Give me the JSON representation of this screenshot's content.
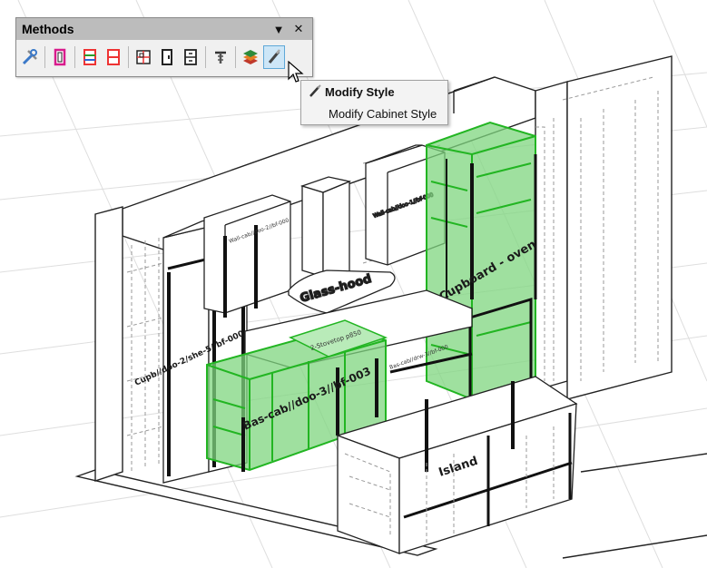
{
  "toolbar": {
    "title": "Methods",
    "buttons": [
      {
        "name": "tools-icon"
      },
      {
        "name": "frame-icon"
      },
      {
        "name": "shelves-color-icon"
      },
      {
        "name": "shelves-red-icon"
      },
      {
        "name": "grid-icon"
      },
      {
        "name": "door-icon"
      },
      {
        "name": "drawer-icon"
      },
      {
        "name": "hinge-icon"
      },
      {
        "name": "layers-icon"
      },
      {
        "name": "brush-icon"
      }
    ]
  },
  "menu": {
    "items": [
      {
        "label": "Modify Style",
        "style": "bold"
      },
      {
        "label": "Modify Cabinet Style",
        "style": "plain"
      }
    ]
  },
  "scene": {
    "labels": {
      "glass_hood": "Glass-hood",
      "cupboard_oven": "Cupboard - oven",
      "bas_cab": "Bas-cab//doo-3//bf-003",
      "cupb": "Cupb//doo-2/she-5//bf-000",
      "island": "Island",
      "stovetop": "2-Stovetop p850",
      "wall_cab_left": "Wall-cab//doo-2//bf-000",
      "wall_cab_right": "Wall-cab//doo-1//bf-000",
      "counter_mid": "Bas-cab//drw-3//bf-000"
    },
    "highlight_color": "#22b522",
    "highlight_fill": "#7fd67f"
  }
}
